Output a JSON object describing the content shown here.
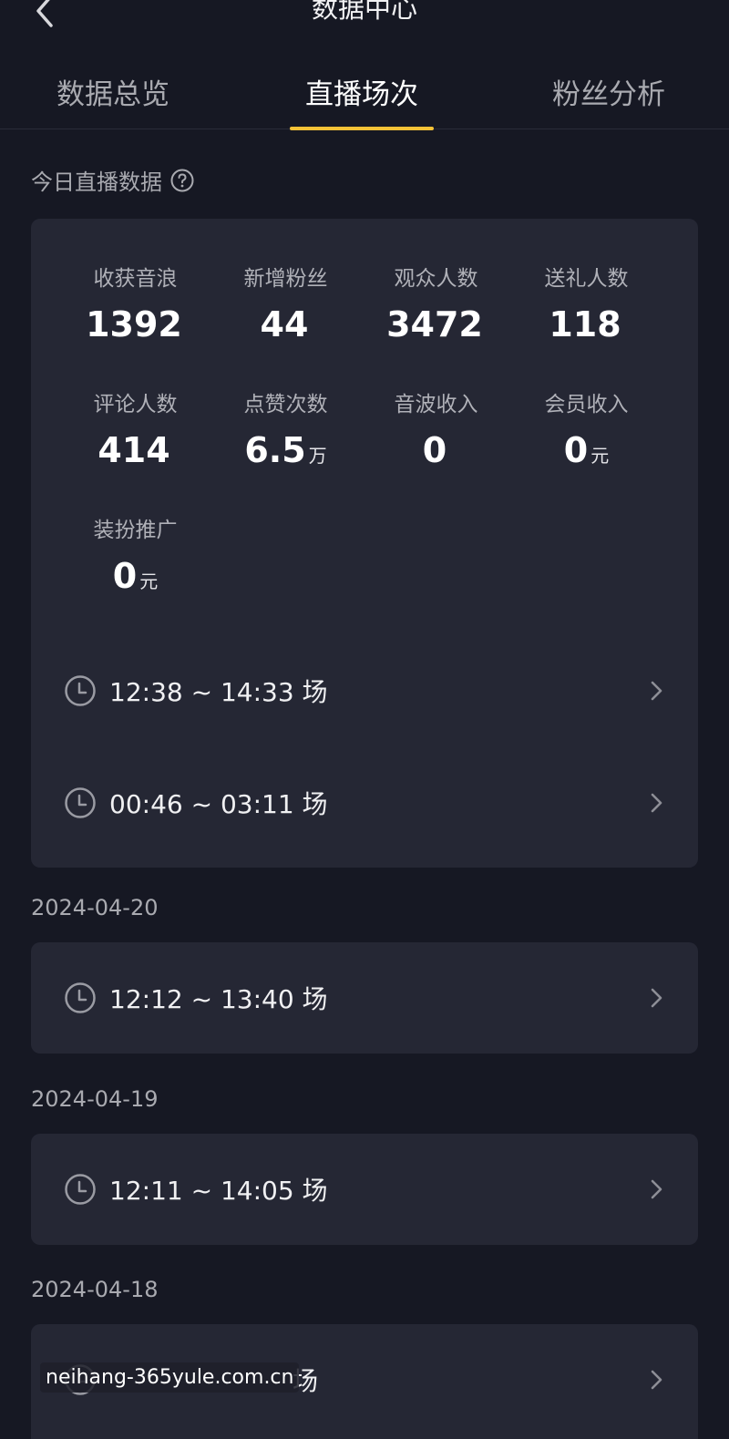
{
  "header": {
    "title": "数据中心"
  },
  "tabs": [
    {
      "label": "数据总览"
    },
    {
      "label": "直播场次"
    },
    {
      "label": "粉丝分析"
    }
  ],
  "active_tab": "直播场次",
  "accent_color": "#f6c237",
  "today": {
    "title": "今日直播数据",
    "stats": [
      {
        "label": "收获音浪",
        "value": "1392",
        "unit": ""
      },
      {
        "label": "新增粉丝",
        "value": "44",
        "unit": ""
      },
      {
        "label": "观众人数",
        "value": "3472",
        "unit": ""
      },
      {
        "label": "送礼人数",
        "value": "118",
        "unit": ""
      },
      {
        "label": "评论人数",
        "value": "414",
        "unit": ""
      },
      {
        "label": "点赞次数",
        "value": "6.5",
        "unit": "万"
      },
      {
        "label": "音波收入",
        "value": "0",
        "unit": ""
      },
      {
        "label": "会员收入",
        "value": "0",
        "unit": "元"
      },
      {
        "label": "装扮推广",
        "value": "0",
        "unit": "元"
      }
    ],
    "sessions": [
      {
        "label": "12:38 ~ 14:33 场"
      },
      {
        "label": "00:46 ~ 03:11 场"
      }
    ]
  },
  "history": [
    {
      "date": "2024-04-20",
      "sessions": [
        {
          "label": "12:12 ~ 13:40 场"
        }
      ]
    },
    {
      "date": "2024-04-19",
      "sessions": [
        {
          "label": "12:11 ~ 14:05 场"
        }
      ]
    },
    {
      "date": "2024-04-18",
      "sessions": [
        {
          "label": "场"
        }
      ]
    }
  ],
  "watermark": "neihang-365yule.com.cn"
}
